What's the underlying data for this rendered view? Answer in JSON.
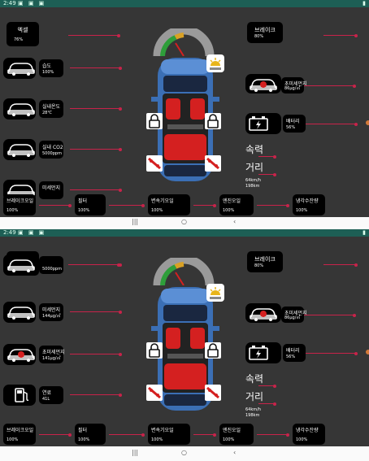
{
  "status_bar": {
    "time": "2:49",
    "icons": "▣ ▣ ▣",
    "battery_icon": "battery-icon"
  },
  "screens": [
    {
      "accel": {
        "label": "엑셀",
        "value": "76%"
      },
      "brake": {
        "label": "브레이크",
        "value": "80%"
      },
      "left_stats": [
        {
          "label": "습도",
          "value": "100%"
        },
        {
          "label": "실내온도",
          "value": "28℃"
        },
        {
          "label": "실내 CO2",
          "value": "5000ppm"
        },
        {
          "label": "미세먼지",
          "value": ""
        }
      ],
      "right_stats": [
        {
          "label": "초미세먼지",
          "value": "86μg/㎥"
        },
        {
          "label": "배터리",
          "value": "56%"
        }
      ],
      "speed_label": "속력",
      "distance_label": "거리",
      "speed_value": "64km/h",
      "distance_value": "198km",
      "bottom": [
        {
          "label": "브레이크오일",
          "value": "100%"
        },
        {
          "label": "필터",
          "value": "100%"
        },
        {
          "label": "변속기오일",
          "value": "100%"
        },
        {
          "label": "엔진오일",
          "value": "100%"
        },
        {
          "label": "냉각수잔량",
          "value": "100%"
        }
      ]
    },
    {
      "accel": {
        "label": "엑셀",
        "value": "76%"
      },
      "brake": {
        "label": "브레이크",
        "value": "80%"
      },
      "left_stats": [
        {
          "label": "",
          "value": "5000ppm"
        },
        {
          "label": "미세먼지",
          "value": "144μg/㎥"
        },
        {
          "label": "초미세먼지",
          "value": "141μg/㎥"
        },
        {
          "label": "연료",
          "value": "41L"
        }
      ],
      "right_stats": [
        {
          "label": "초미세먼지",
          "value": "86μg/㎥"
        },
        {
          "label": "배터리",
          "value": "56%"
        }
      ],
      "speed_label": "속력",
      "distance_label": "거리",
      "speed_value": "64km/h",
      "distance_value": "198km",
      "bottom": [
        {
          "label": "브레이크오일",
          "value": "100%"
        },
        {
          "label": "필터",
          "value": "100%"
        },
        {
          "label": "변속기오일",
          "value": "100%"
        },
        {
          "label": "엔진오일",
          "value": "100%"
        },
        {
          "label": "냉각수잔량",
          "value": "100%"
        }
      ]
    }
  ],
  "navbar": {
    "recent": "|||",
    "home": "○",
    "back": "‹"
  },
  "colors": {
    "panel": "#363636",
    "accent": "#c8234a",
    "status": "#1d5f55",
    "car": "#3b6fb5",
    "seat": "#d42020"
  }
}
